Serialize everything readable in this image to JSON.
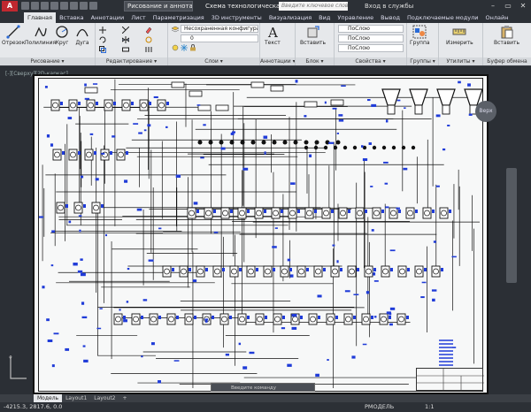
{
  "title_bar": {
    "app_letter": "A",
    "workspace": "Рисование и аннотации",
    "document_title": "Схема технологическая щ...",
    "search_placeholder": "Введите ключевое слово/фразу",
    "signin": "Вход в службы",
    "win_minimize": "–",
    "win_restore": "▭",
    "win_close": "✕"
  },
  "ribbon_tabs": [
    "Главная",
    "Вставка",
    "Аннотации",
    "Лист",
    "Параметризация",
    "3D инструменты",
    "Визуализация",
    "Вид",
    "Управление",
    "Вывод",
    "Подключаемые модули",
    "Онлайн"
  ],
  "ribbon": {
    "draw": {
      "label": "Рисование ▾",
      "line": "Отрезок",
      "polyline": "Полилиния",
      "circle": "Круг",
      "arc": "Дуга"
    },
    "modify": {
      "label": "Редактирование ▾"
    },
    "layers": {
      "label": "Слои ▾",
      "layer_state": "Несохраненная конфигурация слое",
      "current_layer": "0"
    },
    "annotation": {
      "label": "Аннотации ▾",
      "text": "Текст"
    },
    "block": {
      "label": "Блок ▾",
      "insert": "Вставить"
    },
    "properties": {
      "label": "Свойства ▾",
      "color": "ПоСлою",
      "linetype": "ПоСлою",
      "lineweight": "ПоСлою"
    },
    "groups": {
      "label": "Группы ▾",
      "group": "Группа"
    },
    "utilities": {
      "label": "Утилиты ▾",
      "measure": "Измерить"
    },
    "clipboard": {
      "label": "Буфер обмена",
      "paste": "Вставить"
    }
  },
  "canvas": {
    "viewport_label": "[-][Сверху][2D-каркас]",
    "viewcube_face": "Верх",
    "command_prompt": "Введите команду"
  },
  "layout_tabs": [
    "Модель",
    "Layout1",
    "Layout2",
    "+"
  ],
  "status_bar": {
    "coords": "-4215.3, 2817.6, 0.0",
    "mode": "РМОДЕЛЬ",
    "scale": "1:1"
  },
  "colors": {
    "app_red": "#c0282f",
    "title_dark": "#2c3036",
    "ribbon_bg": "#e6e8eb",
    "paper": "#f7f8f8",
    "entity_blue": "#1f3bd8",
    "entity_black": "#111111"
  }
}
